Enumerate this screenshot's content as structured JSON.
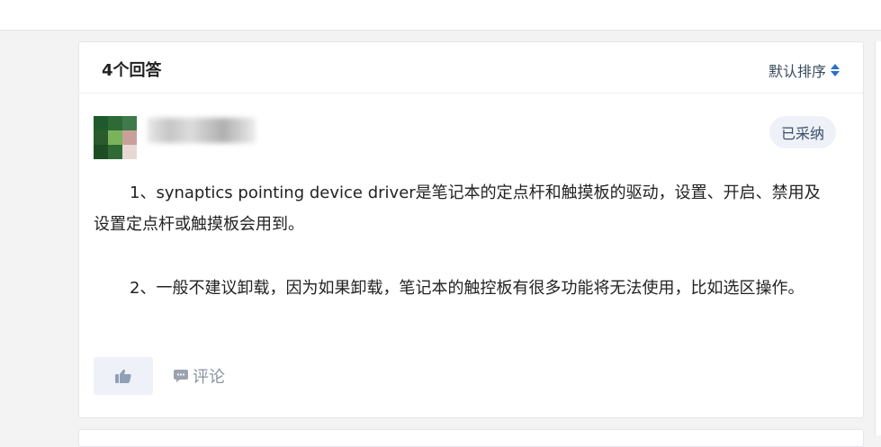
{
  "answers_header": {
    "count_label": "4个回答",
    "sort_label": "默认排序",
    "sort_icon": "sort-updown-icon"
  },
  "answer": {
    "author": {
      "avatar_icon": "user-avatar-icon",
      "name_obscured": true
    },
    "badge": "已采纳",
    "paragraphs": [
      "1、synaptics pointing device driver是笔记本的定点杆和触摸板的驱动，设置、开启、禁用及设置定点杆或触摸板会用到。",
      "2、一般不建议卸载，因为如果卸载，笔记本的触控板有很多功能将无法使用，比如选区操作。"
    ],
    "actions": {
      "like_icon": "thumbs-up-icon",
      "comment_icon": "comment-bubble-icon",
      "comment_label": "评论"
    }
  },
  "colors": {
    "accent": "#2e6fc7",
    "badge_bg": "#eef2f8",
    "muted": "#8a93a0"
  }
}
